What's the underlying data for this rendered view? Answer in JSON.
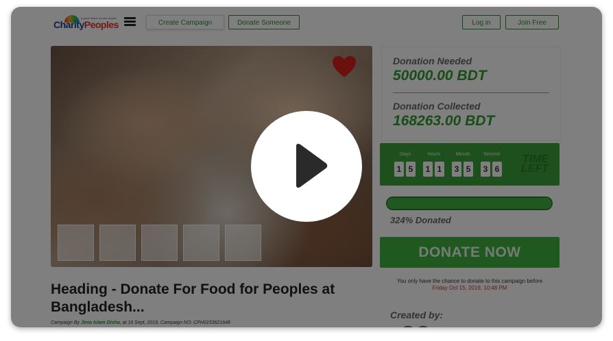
{
  "header": {
    "logo_text_1": "Charity",
    "logo_text_2": "Peoples",
    "logo_tagline": "a place where heroes donate",
    "create_campaign": "Create Campaign",
    "donate_someone": "Donate Someone",
    "login": "Log in",
    "join_free": "Join Free"
  },
  "campaign": {
    "title": "Heading - Donate For Food for Peoples at Bangladesh...",
    "byline_prefix": "Campaign By ",
    "author": "Jinia Islam Disha",
    "byline_suffix": ", at 16 Sept, 2019, Campaign NO: CPH0153621648"
  },
  "donation": {
    "needed_label": "Donation Needed",
    "needed_amount": "50000.00 BDT",
    "collected_label": "Donation Collected",
    "collected_amount": "168263.00 BDT"
  },
  "countdown": {
    "labels": [
      "Days",
      "Hours",
      "Minute",
      "Second"
    ],
    "days": [
      "1",
      "5"
    ],
    "hours": [
      "1",
      "1"
    ],
    "minutes": [
      "3",
      "5"
    ],
    "seconds": [
      "3",
      "6"
    ],
    "time_left_1": "TIME",
    "time_left_2": "LEFT"
  },
  "progress": {
    "fraction": 1.0,
    "label": "324% Donated"
  },
  "donate_now": "DONATE NOW",
  "chance": {
    "text": "You only have the chance to donate to this campaign before ",
    "deadline": "Friday Oct 15, 2019, 10:48 PM"
  },
  "created_by": "Created by:",
  "colors": {
    "brand_green": "#3fb33f",
    "dark_green": "#2c7d2c",
    "deadline_red": "#d12b2b",
    "overlay": "rgba(0,0,0,0.5)"
  },
  "icons": {
    "favorite": "heart-icon",
    "menu": "hamburger-menu-icon",
    "video": "play-icon"
  }
}
